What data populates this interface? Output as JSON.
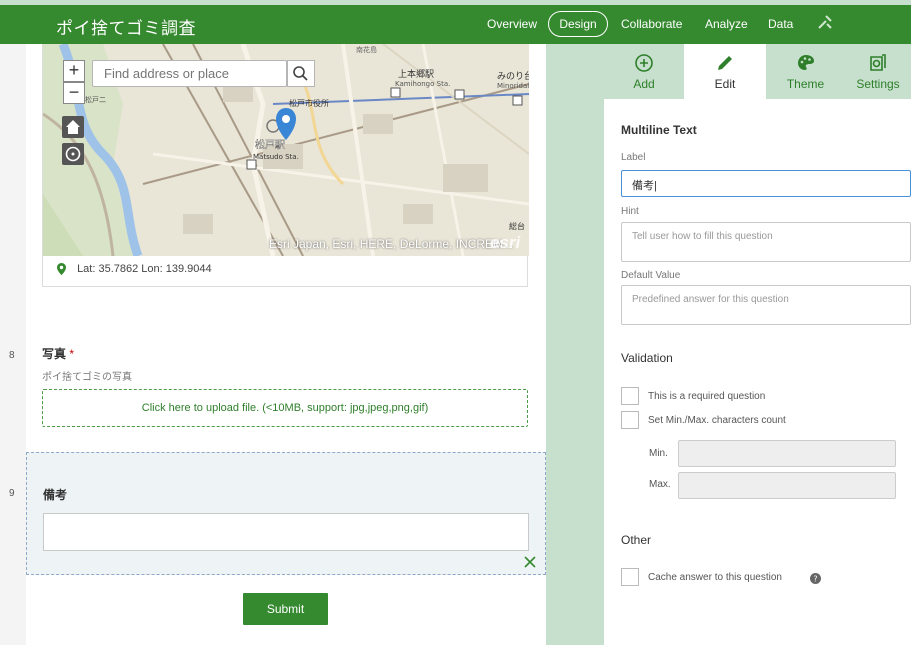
{
  "header": {
    "title": "ポイ捨てゴミ調査",
    "nav": [
      "Overview",
      "Design",
      "Collaborate",
      "Analyze",
      "Data"
    ],
    "active_nav": "Design"
  },
  "left_strip": {
    "numbers": [
      "8",
      "9"
    ]
  },
  "map": {
    "search_placeholder": "Find address or place",
    "zoom_in": "+",
    "zoom_out": "−",
    "attribution": "Esri Japan, Esri, HERE, DeLorme, INCREM...",
    "logo": "esri",
    "coordinates": "Lat: 35.7862 Lon: 139.9044",
    "place_labels": [
      "上本郷駅",
      "Kamihongo Sta.",
      "みのり台",
      "Minoridai",
      "松戸駅",
      "Matsudo Sta.",
      "南花島",
      "総台",
      "松戸二",
      "松戸市役所"
    ]
  },
  "questions": {
    "photo": {
      "label": "写真",
      "required_mark": "*",
      "hint": "ポイ捨てゴミの写真",
      "upload_text": "Click here to upload file. (<10MB, support: jpg,jpeg,png,gif)"
    },
    "memo": {
      "label": "備考"
    }
  },
  "submit_label": "Submit",
  "panel": {
    "tabs": [
      {
        "label": "Add",
        "icon": "add-circle-icon"
      },
      {
        "label": "Edit",
        "icon": "pencil-icon"
      },
      {
        "label": "Theme",
        "icon": "palette-icon"
      },
      {
        "label": "Settings",
        "icon": "settings-gear-icon"
      }
    ],
    "active_tab": "Edit",
    "section_title": "Multiline Text",
    "label_field": {
      "label": "Label",
      "value": "備考|"
    },
    "hint_field": {
      "label": "Hint",
      "placeholder": "Tell user how to fill this question"
    },
    "default_field": {
      "label": "Default Value",
      "placeholder": "Predefined answer for this question"
    },
    "validation": {
      "title": "Validation",
      "required_label": "This is a required question",
      "minmax_label": "Set Min./Max. characters count",
      "min_label": "Min.",
      "max_label": "Max."
    },
    "other": {
      "title": "Other",
      "cache_label": "Cache answer to this question"
    }
  },
  "colors": {
    "brand_green": "#35892f",
    "panel_tab_bg": "#c6e0cd",
    "focus_blue": "#4a90d9",
    "required_red": "#cc0000"
  }
}
